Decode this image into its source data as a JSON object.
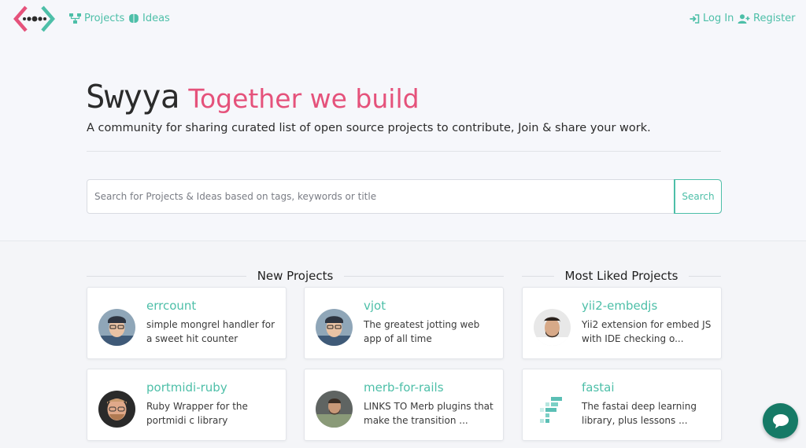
{
  "nav": {
    "projects_label": "Projects",
    "ideas_label": "Ideas",
    "login_label": "Log In",
    "register_label": "Register"
  },
  "hero": {
    "brand": "Swyya",
    "tagline": "Together we build",
    "subtitle": "A community for sharing curated list of open source projects to contribute, Join & share your work."
  },
  "search": {
    "placeholder": "Search for Projects & Ideas based on tags, keywords or title",
    "value": "",
    "button_label": "Search"
  },
  "sections": {
    "new_projects": {
      "title": "New Projects",
      "cards": [
        {
          "title": "errcount",
          "description": "simple mongrel handler for a sweet hit counter"
        },
        {
          "title": "vjot",
          "description": "The greatest jotting web app of all time"
        },
        {
          "title": "portmidi-ruby",
          "description": "Ruby Wrapper for the portmidi c library"
        },
        {
          "title": "merb-for-rails",
          "description": "LINKS TO Merb plugins that make the transition ..."
        }
      ]
    },
    "most_liked": {
      "title": "Most Liked Projects",
      "cards": [
        {
          "title": "yii2-embedjs",
          "description": "Yii2 extension for embed JS with IDE checking o..."
        },
        {
          "title": "fastai",
          "description": "The fastai deep learning library, plus lessons ..."
        }
      ]
    }
  },
  "colors": {
    "accent": "#4dbfa8",
    "tagline": "#e5527b",
    "chat": "#167a66"
  }
}
